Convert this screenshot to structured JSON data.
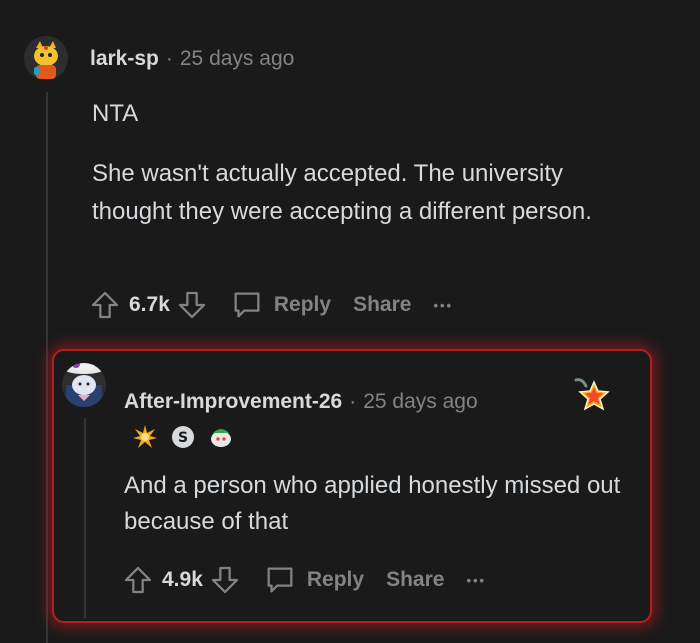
{
  "comments": [
    {
      "username": "lark-sp",
      "separator": "·",
      "time": "25 days ago",
      "paragraphs": [
        "NTA",
        "She wasn't actually accepted. The university thought they were accepting a different person."
      ],
      "score": "6.7k",
      "reply_label": "Reply",
      "share_label": "Share",
      "more_label": "•••"
    },
    {
      "username": "After-Improvement-26",
      "separator": "·",
      "time": "25 days ago",
      "body": "And a person who applied honestly missed out because of that",
      "score": "4.9k",
      "reply_label": "Reply",
      "share_label": "Share",
      "more_label": "•••",
      "flairs": [
        "starburst-flair-icon",
        "s-badge-flair-icon",
        "snoo-flair-icon"
      ]
    }
  ],
  "colors": {
    "background": "#1a1a1b",
    "text": "#d7dadc",
    "muted": "#818384",
    "highlight_border": "#b02020"
  }
}
